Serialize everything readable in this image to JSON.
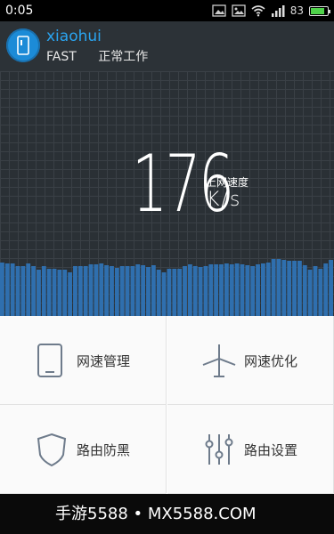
{
  "status_bar": {
    "time": "0:05",
    "battery_percent": "83",
    "icons": [
      "image-icon",
      "gallery-icon",
      "wifi-icon",
      "signal-icon",
      "battery-icon"
    ],
    "battery_color": "#4fd24a"
  },
  "header": {
    "router_name": "xiaohui",
    "band": "FAST",
    "status": "正常工作",
    "name_color": "#2aa4f0",
    "avatar_color": "#1c8bd7",
    "avatar_icon": "router-device-icon"
  },
  "speed": {
    "value": "176",
    "label": "上网速度",
    "unit": "K/s",
    "bar_color": "#2f6fae",
    "history": [
      60,
      59,
      59,
      56,
      56,
      59,
      56,
      52,
      56,
      53,
      53,
      52,
      52,
      49,
      56,
      56,
      56,
      58,
      58,
      59,
      57,
      56,
      54,
      56,
      56,
      56,
      58,
      57,
      55,
      57,
      52,
      49,
      53,
      53,
      53,
      56,
      58,
      56,
      55,
      56,
      58,
      58,
      58,
      59,
      58,
      59,
      58,
      57,
      56,
      58,
      59,
      60,
      64,
      64,
      63,
      62,
      62,
      62,
      57,
      52,
      56,
      53,
      59,
      63
    ]
  },
  "menu": {
    "items": [
      {
        "label": "网速管理",
        "icon": "tablet-icon"
      },
      {
        "label": "网速优化",
        "icon": "windmill-icon"
      },
      {
        "label": "路由防黑",
        "icon": "shield-icon"
      },
      {
        "label": "路由设置",
        "icon": "sliders-icon"
      }
    ]
  },
  "bottom_bar": {
    "watermark": "手游5588 • MX5588.COM"
  }
}
